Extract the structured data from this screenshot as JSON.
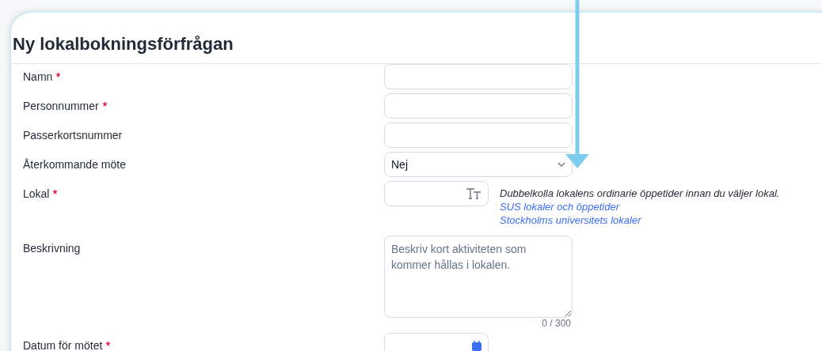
{
  "dialog": {
    "title": "Ny lokalbokningsförfrågan"
  },
  "fields": [
    {
      "kind": "text",
      "label": "Namn",
      "required": true
    },
    {
      "kind": "text",
      "label": "Personnummer",
      "required": true
    },
    {
      "kind": "text",
      "label": "Passerkortsnummer",
      "required": false
    },
    {
      "kind": "select",
      "label": "Återkommande möte",
      "required": false,
      "value": "Nej"
    },
    {
      "kind": "lookup",
      "label": "Lokal",
      "required": true,
      "note": "Dubbelkolla lokalens ordinarie öppetider innan du väljer lokal.",
      "links": [
        "SUS lokaler och öppetider",
        "Stockholms universitets lokaler"
      ]
    },
    {
      "kind": "textarea",
      "label": "Beskrivning",
      "required": false,
      "placeholder": "Beskriv kort aktiviteten som kommer hållas i lokalen.",
      "counter": "0 / 300"
    },
    {
      "kind": "date",
      "label": "Datum för mötet",
      "required": true
    }
  ]
}
